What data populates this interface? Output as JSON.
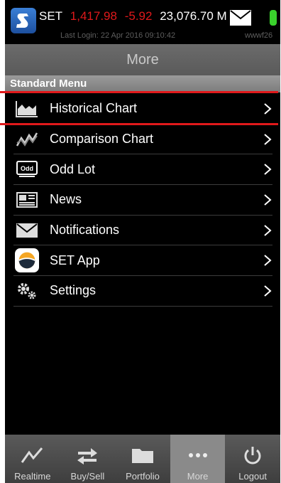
{
  "ticker": {
    "index_name": "SET",
    "index_value": "1,417.98",
    "change": "-5.92",
    "value_traded": "23,076.70 M",
    "last_login": "Last Login: 22 Apr 2016 09:10:42",
    "user": "wwwf26"
  },
  "header": {
    "title": "More"
  },
  "section": {
    "title": "Standard Menu"
  },
  "menu": {
    "items": [
      {
        "label": "Historical Chart",
        "icon": "area-chart-icon"
      },
      {
        "label": "Comparison Chart",
        "icon": "comparison-chart-icon"
      },
      {
        "label": "Odd Lot",
        "icon": "odd-lot-icon"
      },
      {
        "label": "News",
        "icon": "news-icon"
      },
      {
        "label": "Notifications",
        "icon": "mail-icon"
      },
      {
        "label": "SET App",
        "icon": "set-app-icon"
      },
      {
        "label": "Settings",
        "icon": "gears-icon"
      }
    ]
  },
  "odd_icon_text": "Odd",
  "tabs": [
    {
      "label": "Realtime",
      "icon": "line-chart-icon"
    },
    {
      "label": "Buy/Sell",
      "icon": "arrows-icon"
    },
    {
      "label": "Portfolio",
      "icon": "folder-icon"
    },
    {
      "label": "More",
      "icon": "more-dots-icon",
      "active": true
    },
    {
      "label": "Logout",
      "icon": "power-icon"
    }
  ],
  "colors": {
    "negative": "#e0191b",
    "accent": "#3ad12c"
  }
}
